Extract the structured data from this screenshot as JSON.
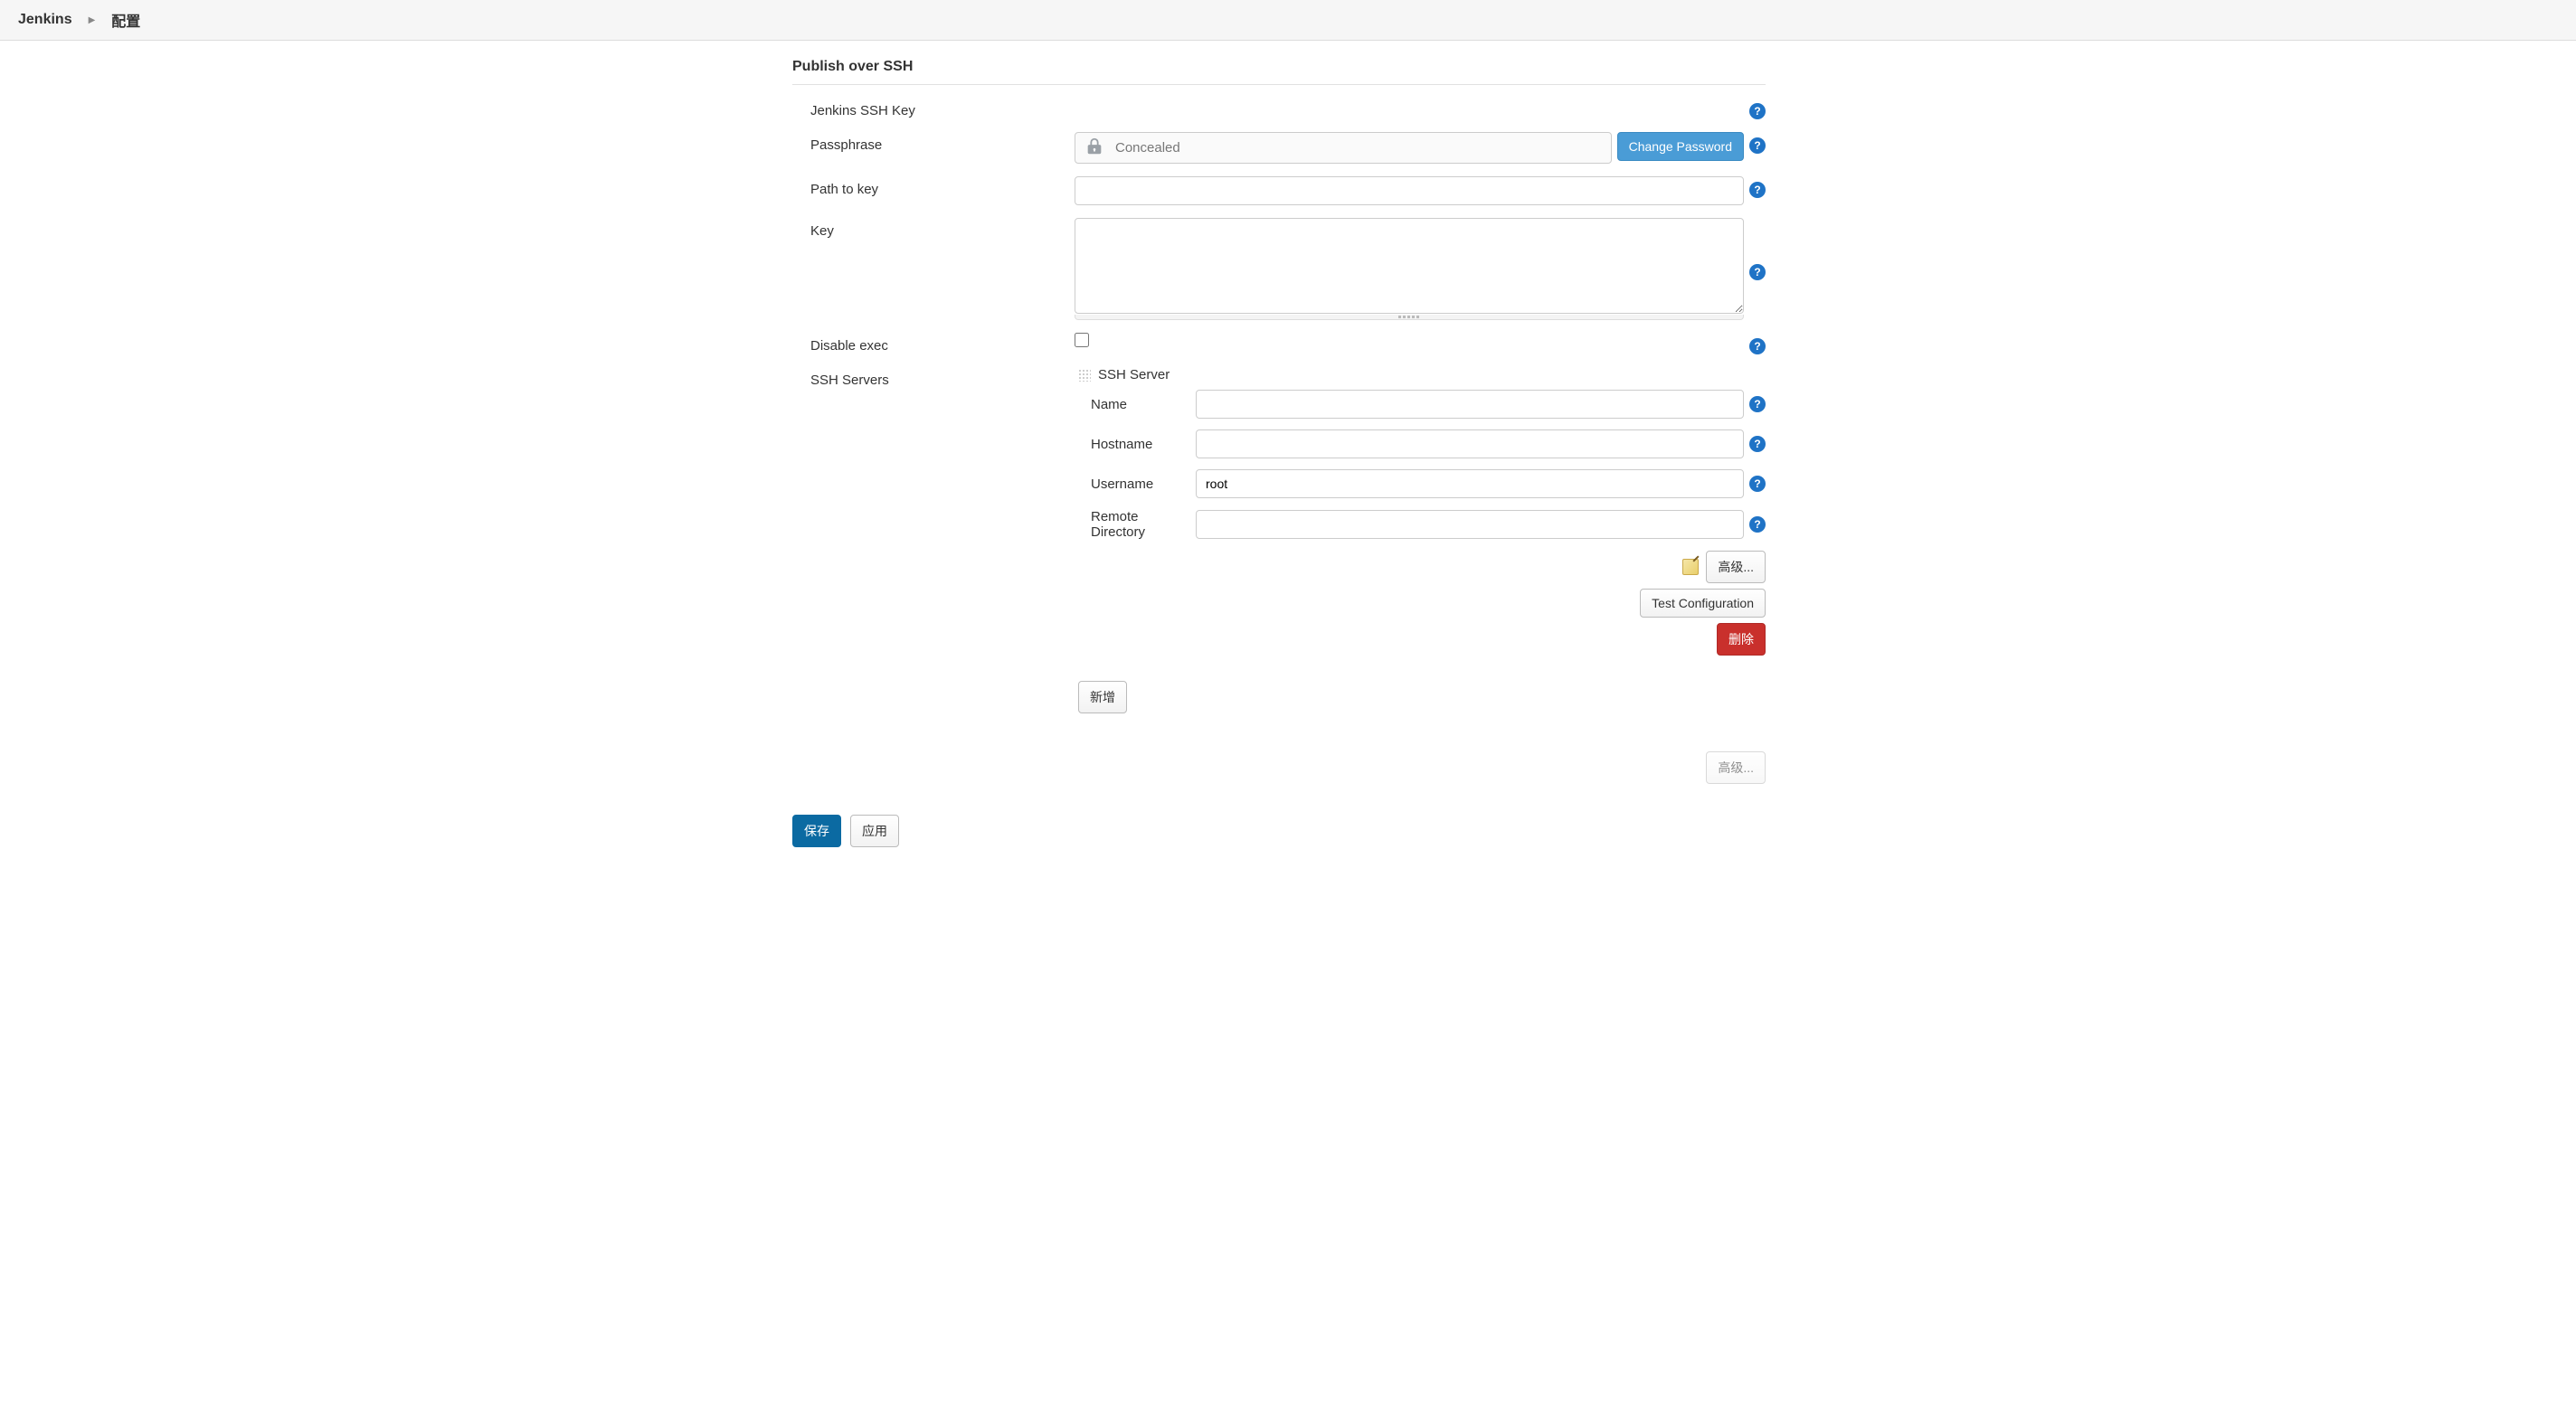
{
  "breadcrumb": {
    "root": "Jenkins",
    "page": "配置"
  },
  "section": {
    "title": "Publish over SSH",
    "sshKeyLabel": "Jenkins SSH Key",
    "passphraseLabel": "Passphrase",
    "passphraseDisplay": "Concealed",
    "changePassword": "Change Password",
    "pathToKeyLabel": "Path to key",
    "pathToKeyValue": "",
    "keyLabel": "Key",
    "keyValue": "",
    "disableExecLabel": "Disable exec",
    "disableExecChecked": false,
    "sshServersLabel": "SSH Servers",
    "server": {
      "header": "SSH Server",
      "nameLabel": "Name",
      "nameValue": "",
      "hostnameLabel": "Hostname",
      "hostnameValue": "",
      "usernameLabel": "Username",
      "usernameValue": "root",
      "remoteDirLabel": "Remote Directory",
      "remoteDirValue": "",
      "advancedLabel": "高级...",
      "testLabel": "Test Configuration",
      "deleteLabel": "删除"
    },
    "addLabel": "新增",
    "advancedBottom": "高级..."
  },
  "actions": {
    "save": "保存",
    "apply": "应用"
  },
  "help": "?"
}
